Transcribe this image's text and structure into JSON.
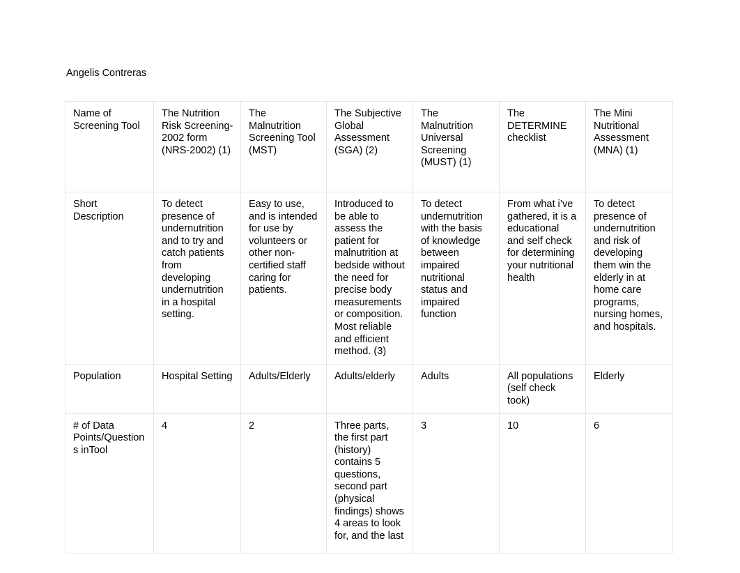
{
  "document": {
    "author": "Angelis Contreras"
  },
  "table": {
    "name": "screening-tool-comparison-table",
    "row_labels": [
      "Name of Screening Tool",
      "Short Description",
      "Population",
      "# of Data Points/Questions inTool"
    ],
    "tools": [
      "The Nutrition Risk Screening-2002 form (NRS-2002) (1)",
      "The Malnutrition Screening Tool (MST)",
      "The Subjective Global Assessment (SGA) (2)",
      "The Malnutrition Universal Screening (MUST) (1)",
      "The DETERMINE checklist",
      "The Mini Nutritional Assessment (MNA) (1)"
    ],
    "descriptions": [
      "To detect presence of undernutrition and to try and catch patients from developing undernutrition in a hospital setting.",
      "Easy to use, and is intended for use by volunteers or other non-certified staff caring for patients.",
      "Introduced to be able to assess the patient for malnutrition at bedside without the need for precise body measurements or composition. Most reliable and efficient method. (3)",
      "To detect undernutrition with the basis of knowledge between impaired nutritional status and impaired function",
      "From what i’ve gathered, it is a educational and self check for determining your nutritional health",
      "To detect presence of undernutrition and risk of developing them win the elderly in at home care programs, nursing homes, and hospitals."
    ],
    "populations": [
      "Hospital Setting",
      "Adults/Elderly",
      "Adults/elderly",
      "Adults",
      "All populations (self check took)",
      "Elderly"
    ],
    "data_points": [
      "4",
      "2",
      "Three parts, the first part (history) contains 5 questions, second part (physical findings) shows 4 areas to look for, and the last",
      "3",
      "10",
      "6"
    ]
  },
  "style": {
    "gridline_color": "#e6e6e6",
    "text_color": "#000000",
    "page_background": "#ffffff"
  }
}
